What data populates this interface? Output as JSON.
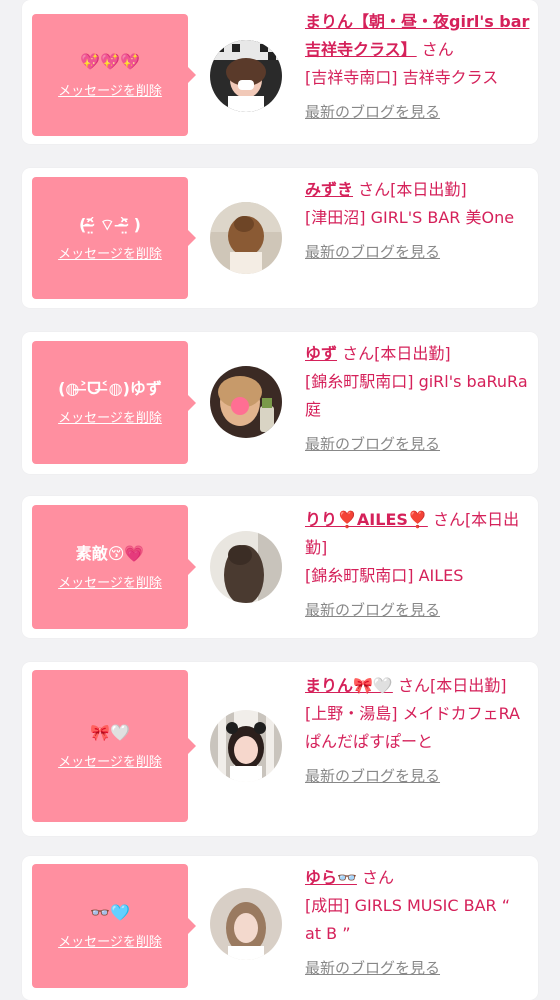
{
  "cards": [
    {
      "message": "💖💖💖",
      "delete_label": "メッセージを削除",
      "name": "まりん【朝・昼・夜girl's bar吉祥寺クラス】",
      "suffix": "さん",
      "shop": "[吉祥寺南口] 吉祥寺クラス",
      "blog_label": "最新のブログを見る"
    },
    {
      "message": "(ᵔ̴̶̤᷄ ⌔ ᵔ̴̶̤᷅ )",
      "delete_label": "メッセージを削除",
      "name": "みずき",
      "suffix": "さん[本日出勤]",
      "shop": "[津田沼] GIRL'S BAR 美One",
      "blog_label": "最新のブログを見る"
    },
    {
      "message": "(◍˃̶ᗜ˂̶◍)ゆず",
      "delete_label": "メッセージを削除",
      "name": "ゆず",
      "suffix": "さん[本日出勤]",
      "shop": "[錦糸町駅南口] giRl's baRuRa庭",
      "blog_label": "最新のブログを見る"
    },
    {
      "message": "素敵😚💗",
      "delete_label": "メッセージを削除",
      "name": "りり❣️AILES❣️",
      "suffix": "さん[本日出勤]",
      "shop": "[錦糸町駅南口] AILES",
      "blog_label": "最新のブログを見る"
    },
    {
      "message": "🎀🤍",
      "delete_label": "メッセージを削除",
      "name": "まりん🎀🤍",
      "suffix": "さん[本日出勤]",
      "shop": "[上野・湯島] メイドカフェRA ぱんだぱすぽーと",
      "blog_label": "最新のブログを見る"
    },
    {
      "message": "👓🩵",
      "delete_label": "メッセージを削除",
      "name": "ゆら👓",
      "suffix": "さん",
      "shop": "[成田] GIRLS MUSIC BAR “ at B ”",
      "blog_label": "最新のブログを見る"
    }
  ]
}
